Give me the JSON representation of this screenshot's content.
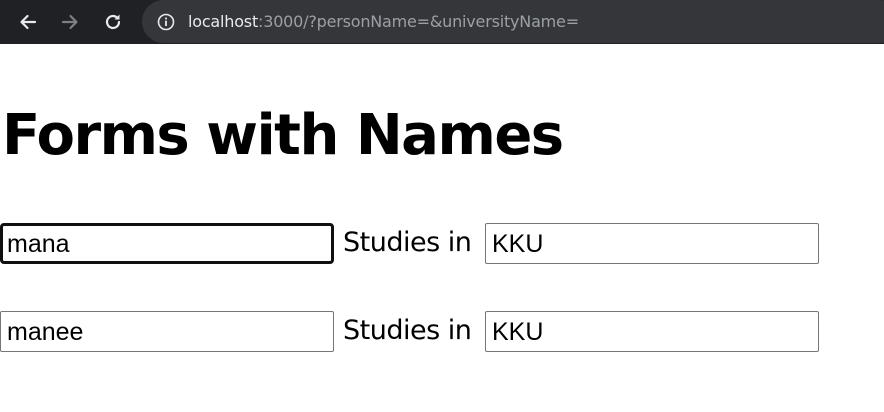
{
  "browser": {
    "url_host": "localhost",
    "url_rest": ":3000/?personName=&universityName="
  },
  "page": {
    "title": "Forms with Names",
    "rows": [
      {
        "person_name": "mana",
        "label": "Studies in",
        "university": "KKU"
      },
      {
        "person_name": "manee",
        "label": "Studies in",
        "university": "KKU"
      }
    ]
  },
  "icons": {
    "back": "back-arrow-icon",
    "forward": "forward-arrow-icon",
    "reload": "reload-icon",
    "info": "info-icon"
  },
  "colors": {
    "chrome_bg": "#202124",
    "address_bg": "#35363a",
    "url_host": "#e8eaed",
    "url_rest": "#9aa0a6",
    "focus_border": "#101010"
  }
}
